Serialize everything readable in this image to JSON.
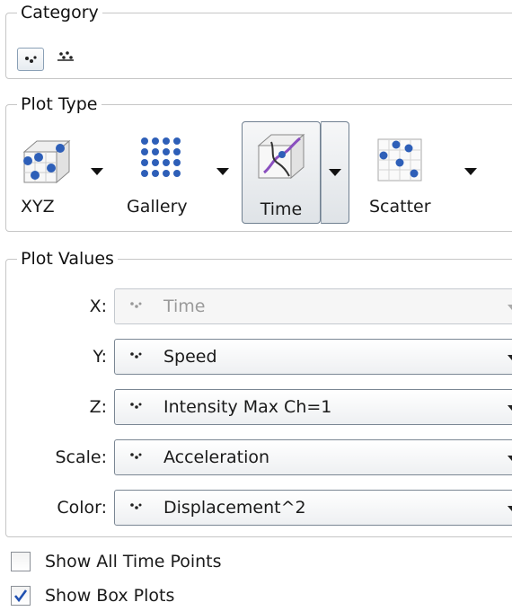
{
  "category": {
    "legend": "Category",
    "items": [
      {
        "icon": "dots-scatter-icon",
        "selected": true
      },
      {
        "icon": "grouped-dots-icon",
        "selected": false
      }
    ]
  },
  "plot_type": {
    "legend": "Plot Type",
    "items": [
      {
        "label": "XYZ",
        "icon": "cube-scatter-icon",
        "selected": false
      },
      {
        "label": "Gallery",
        "icon": "dot-grid-icon",
        "selected": false
      },
      {
        "label": "Time",
        "icon": "time-track-icon",
        "selected": true
      },
      {
        "label": "Scatter",
        "icon": "scatter-grid-icon",
        "selected": false
      }
    ]
  },
  "plot_values": {
    "legend": "Plot Values",
    "rows": [
      {
        "label": "X:",
        "value": "Time",
        "enabled": false
      },
      {
        "label": "Y:",
        "value": "Speed",
        "enabled": true
      },
      {
        "label": "Z:",
        "value": "Intensity Max Ch=1",
        "enabled": true
      },
      {
        "label": "Scale:",
        "value": "Acceleration",
        "enabled": true
      },
      {
        "label": "Color:",
        "value": "Displacement^2",
        "enabled": true
      }
    ]
  },
  "options": {
    "show_all_time_points": {
      "label": "Show All Time Points",
      "checked": false
    },
    "show_box_plots": {
      "label": "Show Box Plots",
      "checked": true
    }
  }
}
